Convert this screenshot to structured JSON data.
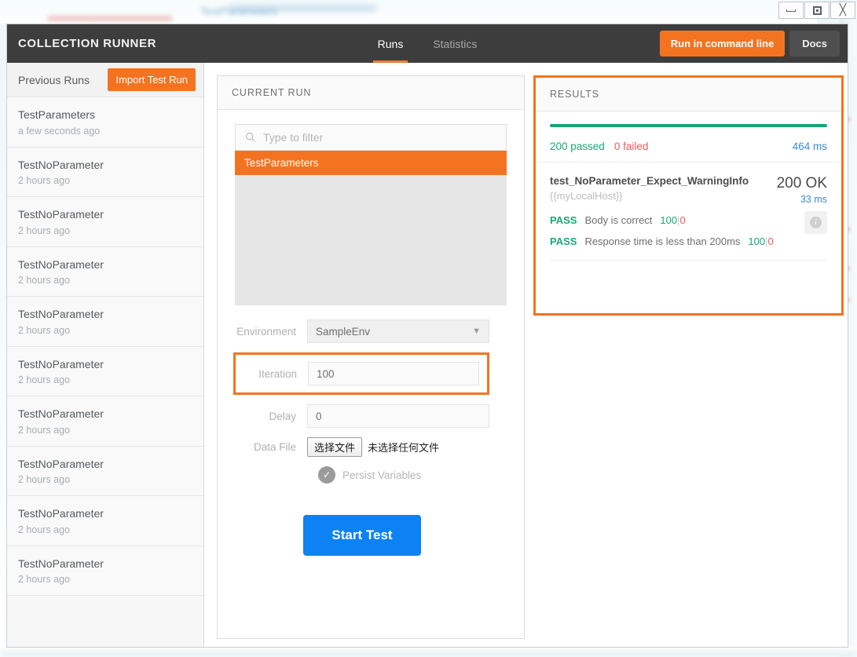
{
  "window": {
    "controls": [
      {
        "name": "minimize",
        "glyph": "minimize-icon"
      },
      {
        "name": "restore",
        "glyph": "restore-icon"
      },
      {
        "name": "close",
        "glyph": "close-icon"
      }
    ]
  },
  "header": {
    "title": "COLLECTION RUNNER",
    "tabs": [
      {
        "label": "Runs",
        "active": true
      },
      {
        "label": "Statistics",
        "active": false
      }
    ],
    "run_command_line_label": "Run in command line",
    "docs_label": "Docs",
    "accent_color": "#f47321",
    "background_color": "#3d3d3d"
  },
  "sidebar": {
    "title": "Previous Runs",
    "import_label": "Import Test Run",
    "runs": [
      {
        "name": "TestParameters",
        "time": "a few seconds ago"
      },
      {
        "name": "TestNoParameter",
        "time": "2 hours ago"
      },
      {
        "name": "TestNoParameter",
        "time": "2 hours ago"
      },
      {
        "name": "TestNoParameter",
        "time": "2 hours ago"
      },
      {
        "name": "TestNoParameter",
        "time": "2 hours ago"
      },
      {
        "name": "TestNoParameter",
        "time": "2 hours ago"
      },
      {
        "name": "TestNoParameter",
        "time": "2 hours ago"
      },
      {
        "name": "TestNoParameter",
        "time": "2 hours ago"
      },
      {
        "name": "TestNoParameter",
        "time": "2 hours ago"
      },
      {
        "name": "TestNoParameter",
        "time": "2 hours ago"
      }
    ]
  },
  "current_run": {
    "title": "CURRENT RUN",
    "filter_placeholder": "Type to filter",
    "filter_value": "",
    "requests": [
      {
        "label": "TestParameters",
        "selected": true
      }
    ],
    "form": {
      "environment_label": "Environment",
      "environment_value": "SampleEnv",
      "iteration_label": "Iteration",
      "iteration_value": "100",
      "delay_label": "Delay",
      "delay_value": "0",
      "data_file_label": "Data File",
      "data_file_button": "选择文件",
      "data_file_status": "未选择任何文件",
      "persist_label": "Persist Variables",
      "persist_checked": true
    },
    "start_label": "Start Test",
    "start_color": "#0d82f5",
    "highlight_color": "#f47321"
  },
  "results": {
    "title": "RESULTS",
    "bar_color": "#16a673",
    "passed": "200 passed",
    "failed": "0 failed",
    "total_time": "464 ms",
    "highlight_color": "#f47321",
    "items": [
      {
        "name": "test_NoParameter_Expect_WarningInfo",
        "url": "{{myLocalHost}}",
        "status_code": "200 OK",
        "response_time": "33 ms",
        "assertions": [
          {
            "result": "PASS",
            "description": "Body is correct",
            "pass_count": "100",
            "separator": "|",
            "fail_count": "0"
          },
          {
            "result": "PASS",
            "description": "Response time is less than 200ms",
            "pass_count": "100",
            "separator": "|",
            "fail_count": "0"
          }
        ]
      }
    ]
  }
}
